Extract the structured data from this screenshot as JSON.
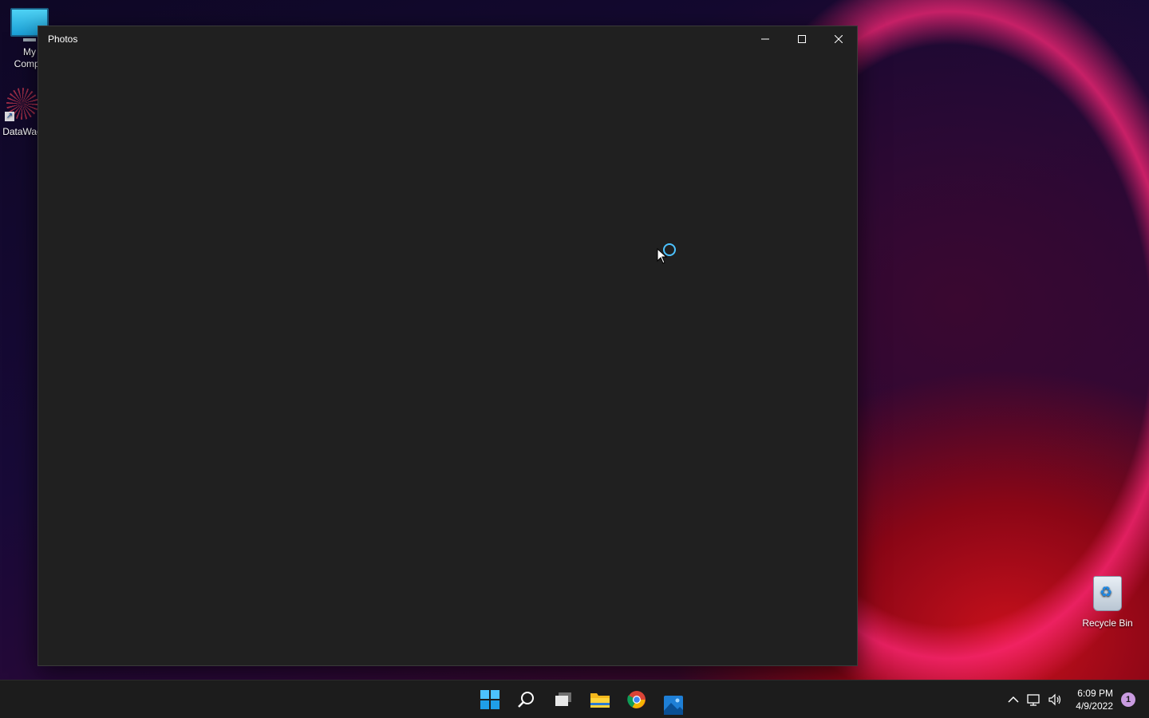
{
  "desktop": {
    "icons": [
      {
        "label": "My\nCompu",
        "icon": "computer-icon"
      },
      {
        "label": "DataWag",
        "icon": "datawag-icon"
      },
      {
        "label": "Recycle Bin",
        "icon": "recycle-bin-icon"
      }
    ]
  },
  "window": {
    "title": "Photos",
    "controls": [
      "minimize-icon",
      "maximize-icon",
      "close-icon"
    ],
    "state": "loading",
    "accent": "#4cc2ff",
    "background": "#202020"
  },
  "taskbar": {
    "apps": [
      {
        "name": "Start",
        "icon": "windows-start-icon"
      },
      {
        "name": "Search",
        "icon": "search-icon"
      },
      {
        "name": "Task View",
        "icon": "task-view-icon"
      },
      {
        "name": "File Explorer",
        "icon": "folder-icon"
      },
      {
        "name": "Google Chrome",
        "icon": "chrome-icon"
      },
      {
        "name": "Photos",
        "icon": "photos-icon"
      }
    ],
    "tray": {
      "icons": [
        "chevron-up-icon",
        "network-icon",
        "volume-icon"
      ],
      "time": "6:09 PM",
      "date": "4/9/2022",
      "notification_count": "1"
    },
    "background": "#1c1c1c"
  }
}
